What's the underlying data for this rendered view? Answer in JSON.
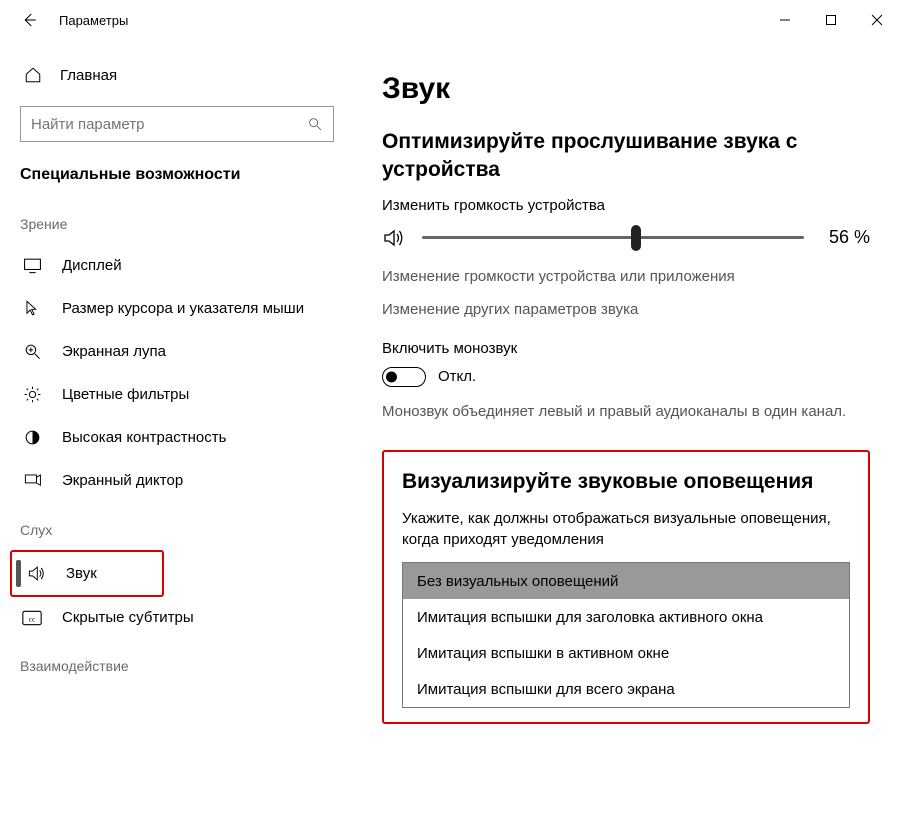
{
  "window": {
    "title": "Параметры"
  },
  "sidebar": {
    "home": "Главная",
    "search_placeholder": "Найти параметр",
    "category": "Специальные возможности",
    "sections": {
      "vision": "Зрение",
      "hearing": "Слух",
      "interaction": "Взаимодействие"
    },
    "items": {
      "display": "Дисплей",
      "cursor": "Размер курсора и указателя мыши",
      "magnifier": "Экранная лупа",
      "color_filters": "Цветные фильтры",
      "high_contrast": "Высокая контрастность",
      "narrator": "Экранный диктор",
      "sound": "Звук",
      "captions": "Скрытые субтитры"
    }
  },
  "main": {
    "title": "Звук",
    "optimize_heading": "Оптимизируйте прослушивание звука с устройства",
    "volume_label": "Изменить громкость устройства",
    "volume_percent_text": "56 %",
    "volume_percent": 56,
    "link1": "Изменение громкости устройства или приложения",
    "link2": "Изменение других параметров звука",
    "mono_label": "Включить монозвук",
    "mono_state": "Откл.",
    "mono_desc": "Монозвук объединяет левый и правый аудиоканалы в один канал.",
    "visualize": {
      "heading": "Визуализируйте звуковые оповещения",
      "hint": "Укажите, как должны отображаться визуальные оповещения, когда приходят уведомления",
      "options": [
        "Без визуальных оповещений",
        "Имитация вспышки для заголовка активного окна",
        "Имитация вспышки в активном окне",
        "Имитация вспышки для всего экрана"
      ]
    }
  }
}
